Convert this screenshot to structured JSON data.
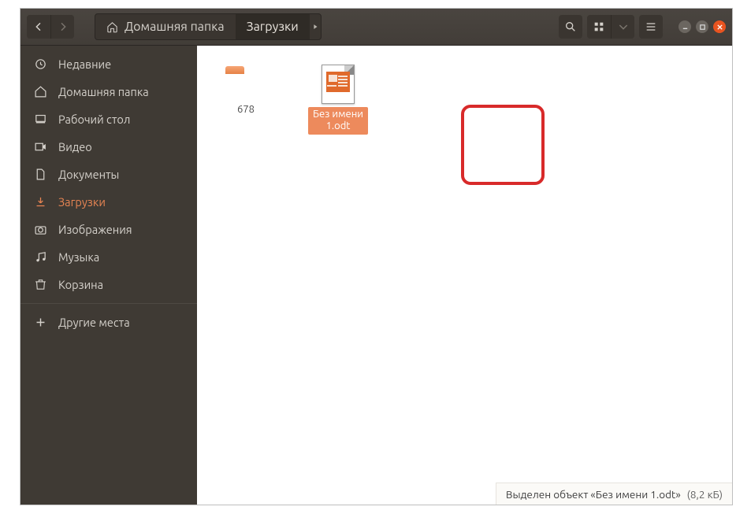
{
  "toolbar": {
    "breadcrumb_home": "Домашняя папка",
    "breadcrumb_current": "Загрузки"
  },
  "sidebar": {
    "items": [
      {
        "label": "Недавние"
      },
      {
        "label": "Домашняя папка"
      },
      {
        "label": "Рабочий стол"
      },
      {
        "label": "Видео"
      },
      {
        "label": "Документы"
      },
      {
        "label": "Загрузки"
      },
      {
        "label": "Изображения"
      },
      {
        "label": "Музыка"
      },
      {
        "label": "Корзина"
      },
      {
        "label": "Другие места"
      }
    ]
  },
  "main": {
    "folder_name": "678",
    "selected_file_line1": "Без имени",
    "selected_file_line2": "1.odt"
  },
  "status": {
    "text": "Выделен объект «Без имени 1.odt»",
    "size": "(8,2 кБ)"
  },
  "colors": {
    "ubuntu_orange": "#e95420",
    "sidebar_bg": "#3f3a34",
    "toolbar_bg": "#423d38",
    "highlight_red": "#d82a2a",
    "selection_orange": "#ed8a5c"
  }
}
